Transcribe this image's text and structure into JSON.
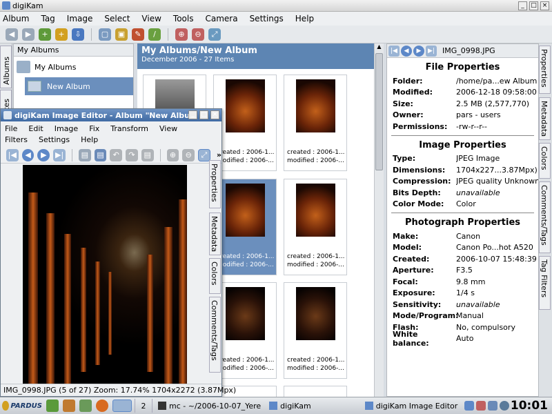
{
  "window": {
    "title": "digiKam"
  },
  "menu": [
    "Album",
    "Tag",
    "Image",
    "Select",
    "View",
    "Tools",
    "Camera",
    "Settings",
    "Help"
  ],
  "left_tabs": [
    "Albums",
    "Dates"
  ],
  "albums": {
    "header": "My Albums",
    "root": "My Albums",
    "child": "New Album"
  },
  "main": {
    "title": "My Albums/New Album",
    "subtitle": "December 2006 - 27 Items"
  },
  "thumbs": [
    {
      "c1": "",
      "c2": ""
    },
    {
      "c1": "created : 2006-1...",
      "c2": "modified : 2006-..."
    },
    {
      "c1": "created : 2006-1...",
      "c2": "modified : 2006-..."
    },
    {
      "c1": "",
      "c2": ""
    },
    {
      "c1": "created : 2006-1...",
      "c2": "modified : 2006-..."
    },
    {
      "c1": "created : 2006-1...",
      "c2": "modified : 2006-..."
    },
    {
      "c1": "",
      "c2": ""
    },
    {
      "c1": "created : 2006-1...",
      "c2": "modified : 2006-..."
    },
    {
      "c1": "created : 2006-1...",
      "c2": "modified : 2006-..."
    }
  ],
  "right_panel": {
    "filename": "IMG_0998.JPG",
    "file_section": "File Properties",
    "file": [
      {
        "k": "Folder:",
        "v": "/home/pa...ew Album"
      },
      {
        "k": "Modified:",
        "v": "2006-12-18 09:58:00"
      },
      {
        "k": "Size:",
        "v": "2.5 MB (2,577,770)"
      },
      {
        "k": "Owner:",
        "v": "pars - users"
      },
      {
        "k": "Permissions:",
        "v": "-rw-r--r--"
      }
    ],
    "image_section": "Image Properties",
    "image": [
      {
        "k": "Type:",
        "v": "JPEG Image"
      },
      {
        "k": "Dimensions:",
        "v": "1704x227...3.87Mpx)"
      },
      {
        "k": "Compression:",
        "v": "JPEG quality Unknown"
      },
      {
        "k": "Bits Depth:",
        "v": "unavailable"
      },
      {
        "k": "Color Mode:",
        "v": "Color"
      }
    ],
    "photo_section": "Photograph Properties",
    "photo": [
      {
        "k": "Make:",
        "v": "Canon"
      },
      {
        "k": "Model:",
        "v": "Canon Po...hot A520"
      },
      {
        "k": "Created:",
        "v": "2006-10-07 15:48:39"
      },
      {
        "k": "Aperture:",
        "v": "F3.5"
      },
      {
        "k": "Focal:",
        "v": "9.8 mm"
      },
      {
        "k": "Exposure:",
        "v": "1/4 s"
      },
      {
        "k": "Sensitivity:",
        "v": "unavailable"
      },
      {
        "k": "Mode/Program:",
        "v": "Manual"
      },
      {
        "k": "Flash:",
        "v": "No, compulsory"
      },
      {
        "k": "White balance:",
        "v": "Auto"
      }
    ]
  },
  "right_tabs": [
    "Properties",
    "Metadata",
    "Colors",
    "Comments/Tags",
    "Tag Filters"
  ],
  "editor": {
    "title": "digiKam Image Editor - Album \"New Album\" - ",
    "menu1": [
      "File",
      "Edit",
      "Image",
      "Fix",
      "Transform",
      "View",
      "Filters"
    ],
    "menu2": [
      "Settings",
      "Help"
    ],
    "status": "IMG_0998.JPG (5 of 27)  Zoom: 17.74%  1704x2272 (3.87Mpx)",
    "tabs": [
      "Properties",
      "Metadata",
      "Colors",
      "Comments/Tags"
    ]
  },
  "taskbar": {
    "brand": "PARDUS",
    "desktop": "2",
    "tasks": [
      "mc - ~/2006-10-07_Yere",
      "digiKam",
      "digiKam Image Editor"
    ],
    "clock": "10:01"
  }
}
